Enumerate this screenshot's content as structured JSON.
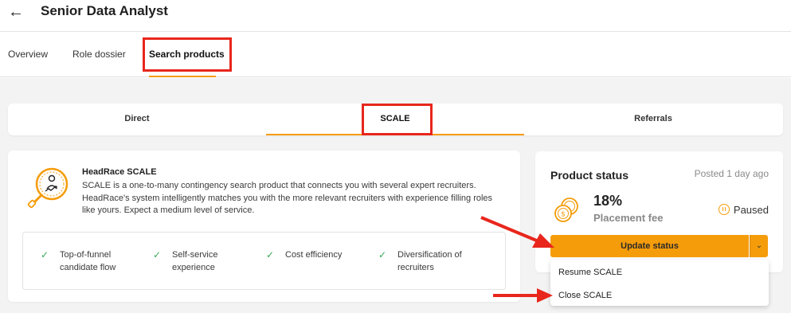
{
  "header": {
    "back_icon": "arrow-left-icon",
    "title": "Senior Data Analyst"
  },
  "tabs": [
    {
      "label": "Overview"
    },
    {
      "label": "Role dossier"
    },
    {
      "label": "Search products"
    }
  ],
  "products": [
    {
      "label": "Direct"
    },
    {
      "label": "SCALE"
    },
    {
      "label": "Referrals"
    }
  ],
  "description": {
    "icon": "scale-search-icon",
    "title": "HeadRace SCALE",
    "text": "SCALE is a one-to-many contingency search product that connects you with several expert recruiters. HeadRace's system intelligently matches you with the more relevant recruiters with experience filling roles like yours. Expect a medium level of service."
  },
  "features": [
    {
      "label": "Top-of-funnel candidate flow"
    },
    {
      "label": "Self-service experience"
    },
    {
      "label": "Cost efficiency"
    },
    {
      "label": "Diversification of recruiters"
    }
  ],
  "status": {
    "title": "Product status",
    "posted": "Posted 1 day ago",
    "fee_value": "18%",
    "fee_label": "Placement fee",
    "state": "Paused",
    "update_button": "Update status"
  },
  "menu": [
    {
      "label": "Resume SCALE"
    },
    {
      "label": "Close SCALE"
    }
  ],
  "colors": {
    "accent": "#f59c0b",
    "annotation": "#e8261c",
    "check": "#3aa957"
  }
}
